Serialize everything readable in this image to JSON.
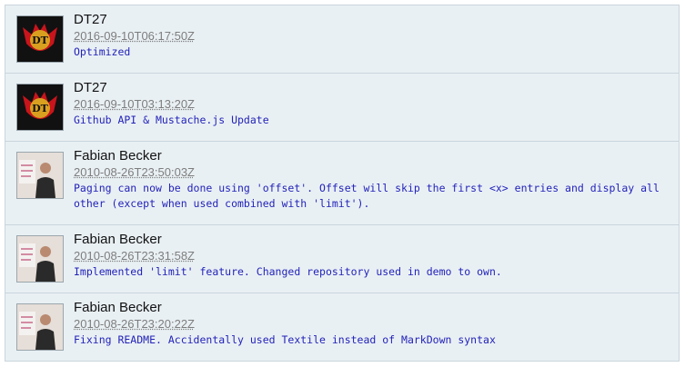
{
  "commits": [
    {
      "author": "DT27",
      "date": "2016-09-10T06:17:50Z",
      "message": "Optimized",
      "avatar": "dt27-logo"
    },
    {
      "author": "DT27",
      "date": "2016-09-10T03:13:20Z",
      "message": "Github API & Mustache.js Update",
      "avatar": "dt27-logo"
    },
    {
      "author": "Fabian Becker",
      "date": "2010-08-26T23:50:03Z",
      "message": "Paging can now be done using 'offset'. Offset will skip the first <x> entries and display all other (except when used combined with 'limit').",
      "avatar": "fabian-photo"
    },
    {
      "author": "Fabian Becker",
      "date": "2010-08-26T23:31:58Z",
      "message": "Implemented 'limit' feature. Changed repository used in demo to own.",
      "avatar": "fabian-photo"
    },
    {
      "author": "Fabian Becker",
      "date": "2010-08-26T23:20:22Z",
      "message": "Fixing README. Accidentally used Textile instead of MarkDown syntax",
      "avatar": "fabian-photo"
    }
  ],
  "colors": {
    "row_bg": "#e9f0f4",
    "message": "#2323b8",
    "date": "#7d7d7d"
  }
}
